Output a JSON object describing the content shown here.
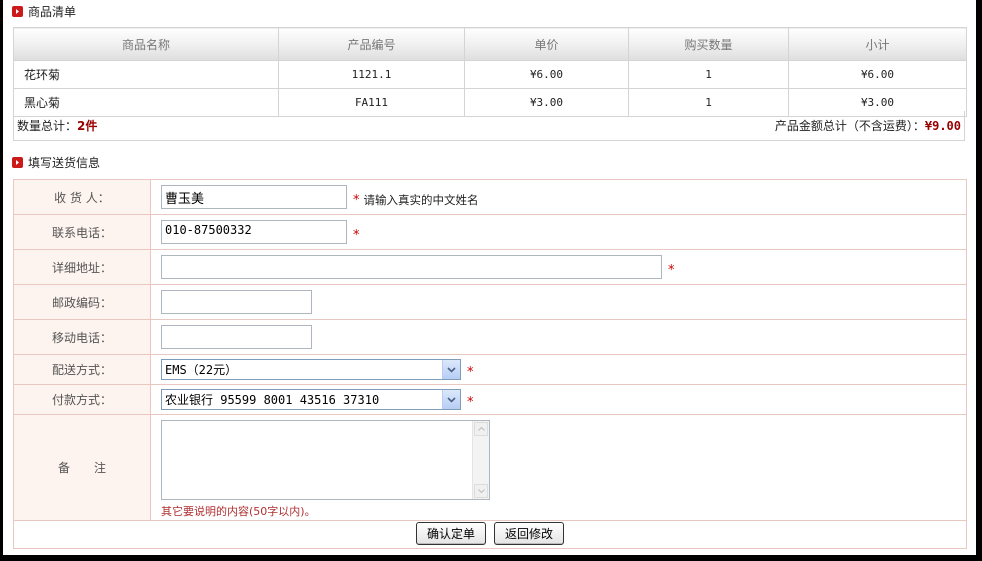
{
  "sections": {
    "goods_title": "商品清单",
    "delivery_title": "填写送货信息"
  },
  "goods": {
    "headers": [
      "商品名称",
      "产品编号",
      "单价",
      "购买数量",
      "小计"
    ],
    "rows": [
      {
        "name": "花环菊",
        "code": "1121.1",
        "price": "¥6.00",
        "qty": "1",
        "subtotal": "¥6.00"
      },
      {
        "name": "黑心菊",
        "code": "FA111",
        "price": "¥3.00",
        "qty": "1",
        "subtotal": "¥3.00"
      }
    ]
  },
  "summary": {
    "count_label": "数量总计：",
    "count_value": "2件",
    "amount_label": "产品金额总计（不含运费）：",
    "amount_value": "¥9.00"
  },
  "form": {
    "receiver": {
      "label": "收 货 人：",
      "value": "曹玉美",
      "hint": "请输入真实的中文姓名"
    },
    "phone": {
      "label": "联系电话：",
      "value": "010-87500332"
    },
    "address": {
      "label": "详细地址：",
      "value": ""
    },
    "postcode": {
      "label": "邮政编码：",
      "value": ""
    },
    "mobile": {
      "label": "移动电话：",
      "value": ""
    },
    "shipping": {
      "label": "配送方式：",
      "selected": "EMS（22元）"
    },
    "payment": {
      "label": "付款方式：",
      "selected": "农业银行 95599 8001 43516 37310"
    },
    "remark": {
      "label": "备　　注",
      "value": "",
      "note": "其它要说明的内容(50字以内)。"
    }
  },
  "buttons": {
    "confirm": "确认定单",
    "back": "返回修改"
  },
  "colors": {
    "accent": "#cc1a1a",
    "amount": "#990000",
    "label_bg": "#fdf3ef"
  },
  "required_mark": "*"
}
